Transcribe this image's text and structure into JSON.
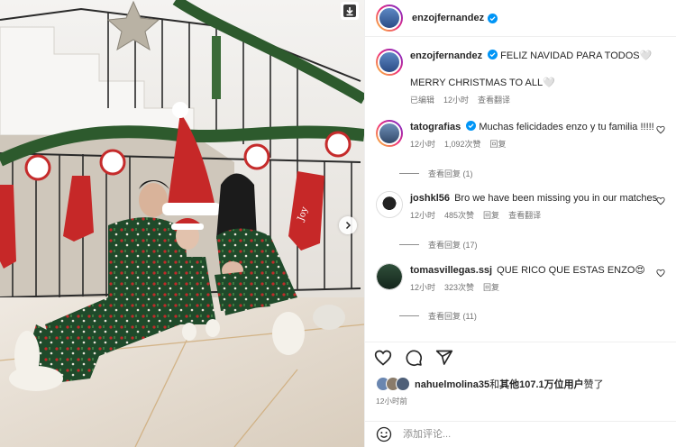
{
  "post": {
    "author": "enzojfernandez",
    "caption_line1": "FELIZ NAVIDAD PARA TODOS🤍",
    "caption_line2": "MERRY CHRISTMAS TO ALL🤍",
    "meta_edited": "已编辑",
    "meta_time": "12小时",
    "meta_translate": "查看翻译",
    "likes_user": "nahuelmolina35",
    "likes_and": "和",
    "likes_others": "其他107.1万位用户",
    "likes_suffix": "赞了",
    "posted_time": "12小时前",
    "photo_stocking_text": "Joy"
  },
  "comments": [
    {
      "user": "tatografias",
      "verified": true,
      "text": "Muchas felicidades enzo y tu familia !!!!!",
      "time": "12小时",
      "likes": "1,092次赞",
      "reply": "回复",
      "translate": "",
      "view_replies": "查看回复 (1)"
    },
    {
      "user": "joshkl56",
      "verified": false,
      "text": "Bro we have been missing you in our matches",
      "time": "12小时",
      "likes": "485次赞",
      "reply": "回复",
      "translate": "查看翻译",
      "view_replies": "查看回复 (17)"
    },
    {
      "user": "tomasvillegas.ssj",
      "verified": false,
      "text": "QUE RICO QUE ESTAS ENZO😍",
      "time": "12小时",
      "likes": "323次赞",
      "reply": "回复",
      "translate": "",
      "view_replies": "查看回复 (11)"
    }
  ],
  "add_comment": {
    "placeholder": "添加评论..."
  },
  "icons": {
    "download": "download-icon",
    "next": "chevron-right-icon",
    "like": "heart-icon",
    "comment": "comment-icon",
    "share": "share-icon",
    "emoji": "emoji-icon",
    "verified": "verified-badge-icon"
  },
  "colors": {
    "verified": "#0095f6",
    "meta": "#737373",
    "divider": "#efefef",
    "text": "#262626"
  }
}
